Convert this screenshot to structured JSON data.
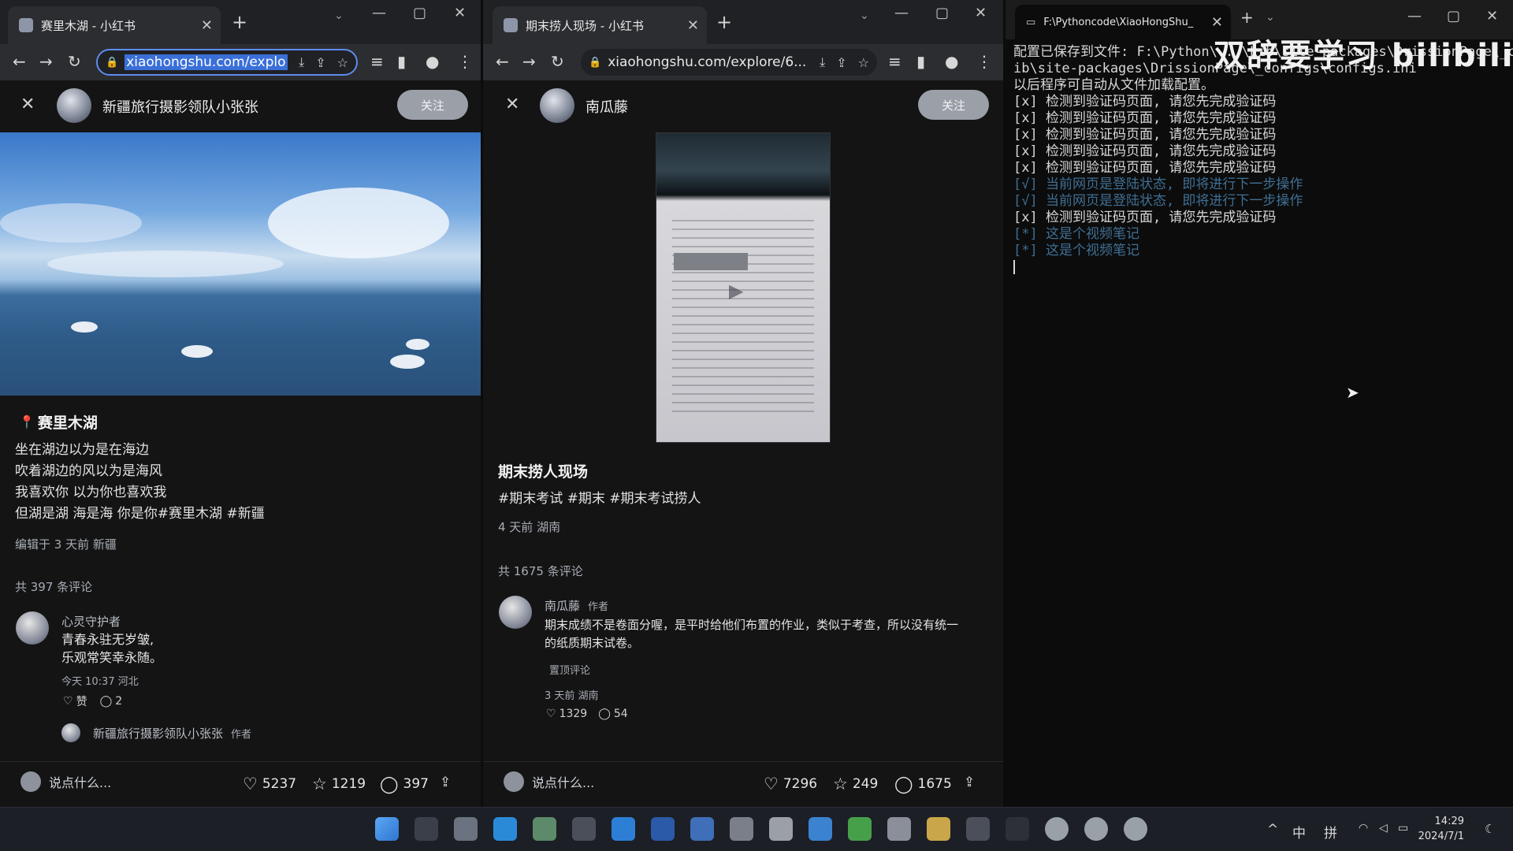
{
  "left_browser": {
    "tab_title": "赛里木湖 - 小红书",
    "url": "xiaohongshu.com/explo",
    "author": "新疆旅行摄影领队小张张",
    "follow_label": "关注",
    "location_title": "赛里木湖",
    "lines": [
      "坐在湖边以为是在海边",
      "吹着湖边的风以为是海风",
      "我喜欢你 以为你也喜欢我",
      "但湖是湖 海是海 你是你#赛里木湖 #新疆"
    ],
    "edited": "编辑于 3 天前 新疆",
    "comments_total": "共 397 条评论",
    "comment": {
      "name": "心灵守护者",
      "text": [
        "青春永驻无岁皱,",
        "乐观常笑幸永随。"
      ],
      "time": "今天 10:37 河北",
      "like_label": "赞",
      "reply_count": "2"
    },
    "reply": {
      "name": "新疆旅行摄影领队小张张",
      "tag": "作者"
    },
    "input_placeholder": "说点什么...",
    "likes": "5237",
    "stars": "1219",
    "comments": "397"
  },
  "mid_browser": {
    "tab_title": "期末捞人现场 - 小红书",
    "url": "xiaohongshu.com/explore/6...",
    "author": "南瓜藤",
    "follow_label": "关注",
    "note_title": "期末捞人现场",
    "tags": "#期末考试 #期末 #期末考试捞人",
    "meta": "4 天前 湖南",
    "comments_total": "共 1675 条评论",
    "comment": {
      "name": "南瓜藤",
      "tag": "作者",
      "text": [
        "期末成绩不是卷面分喔，是平时给他们布置的作业，类似于考查，所以没有统一",
        "的纸质期末试卷。"
      ],
      "pinned": "置顶评论",
      "time": "3 天前 湖南",
      "likes": "1329",
      "replies": "54"
    },
    "input_placeholder": "说点什么...",
    "likes": "7296",
    "stars": "249",
    "comments": "1675"
  },
  "terminal": {
    "tab_title": "F:\\Pythoncode\\XiaoHongShu_",
    "lines": [
      {
        "t": "配置已保存到文件: F:\\Python\\...\\Lib\\site-packages\\DrissionPage\\_configs\\config",
        "dim": false
      },
      {
        "t": "ib\\site-packages\\DrissionPage\\_configs\\configs.ini",
        "dim": false
      },
      {
        "t": "以后程序可自动从文件加载配置。",
        "dim": false
      },
      {
        "t": "[x] 检测到验证码页面, 请您先完成验证码",
        "dim": false
      },
      {
        "t": "[x] 检测到验证码页面, 请您先完成验证码",
        "dim": false
      },
      {
        "t": "[x] 检测到验证码页面, 请您先完成验证码",
        "dim": false
      },
      {
        "t": "[x] 检测到验证码页面, 请您先完成验证码",
        "dim": false
      },
      {
        "t": "[x] 检测到验证码页面, 请您先完成验证码",
        "dim": false
      },
      {
        "t": "[√] 当前网页是登陆状态, 即将进行下一步操作",
        "dim": true
      },
      {
        "t": "[√] 当前网页是登陆状态, 即将进行下一步操作",
        "dim": true
      },
      {
        "t": "[x] 检测到验证码页面, 请您先完成验证码",
        "dim": false
      },
      {
        "t": "[*] 这是个视频笔记",
        "dim": true
      },
      {
        "t": "[*] 这是个视频笔记",
        "dim": true
      }
    ]
  },
  "watermark": "双辞要学习 bilibili",
  "taskbar": {
    "ime1": "中",
    "ime2": "拼",
    "time": "14:29",
    "date": "2024/7/1"
  },
  "colors": {
    "accent": "#3a6fd8",
    "follow_bg": "#9a9fa8",
    "terminal_dim": "#3f6f94"
  }
}
